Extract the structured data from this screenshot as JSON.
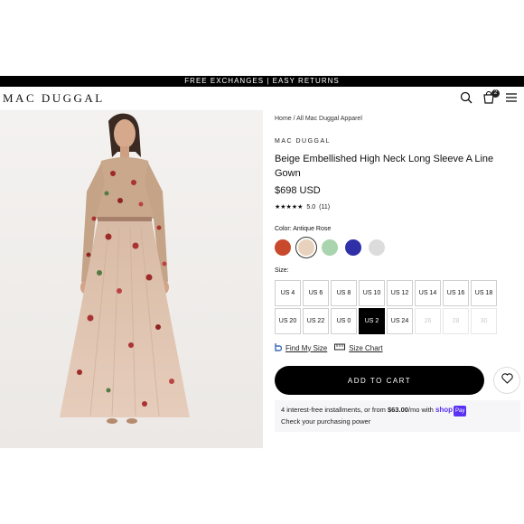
{
  "announcement": "FREE EXCHANGES | EASY RETURNS",
  "header": {
    "logo": "MAC DUGGAL",
    "cart_count": "2"
  },
  "breadcrumb": "Home / All Mac Duggal Apparel",
  "brand": "MAC DUGGAL",
  "product": {
    "title": "Beige Embellished High Neck Long Sleeve A Line Gown",
    "price": "$698 USD",
    "stars": "★★★★★",
    "rating": "5.0",
    "review_count": "(11)"
  },
  "color": {
    "label": "Color: Antique Rose",
    "swatches": [
      "#c8492c",
      "#e9d2bd",
      "#a9d4ad",
      "#2f2fa8",
      "#dcdcdc"
    ]
  },
  "size": {
    "label": "Size:",
    "options": [
      "US 4",
      "US 6",
      "US 8",
      "US 10",
      "US 12",
      "US 14",
      "US 16",
      "US 18",
      "US 20",
      "US 22",
      "US 0",
      "US 2",
      "US 24",
      "26",
      "28",
      "30"
    ]
  },
  "links": {
    "find_my_size": "Find My Size",
    "size_chart": "Size Chart"
  },
  "cart": {
    "add_label": "ADD TO CART"
  },
  "installments": {
    "text_a": "4 interest-free installments, or from ",
    "amount": "$63.00",
    "text_b": "/mo with ",
    "shop": "shop",
    "pay": "Pay",
    "line2": "Check your purchasing power"
  }
}
